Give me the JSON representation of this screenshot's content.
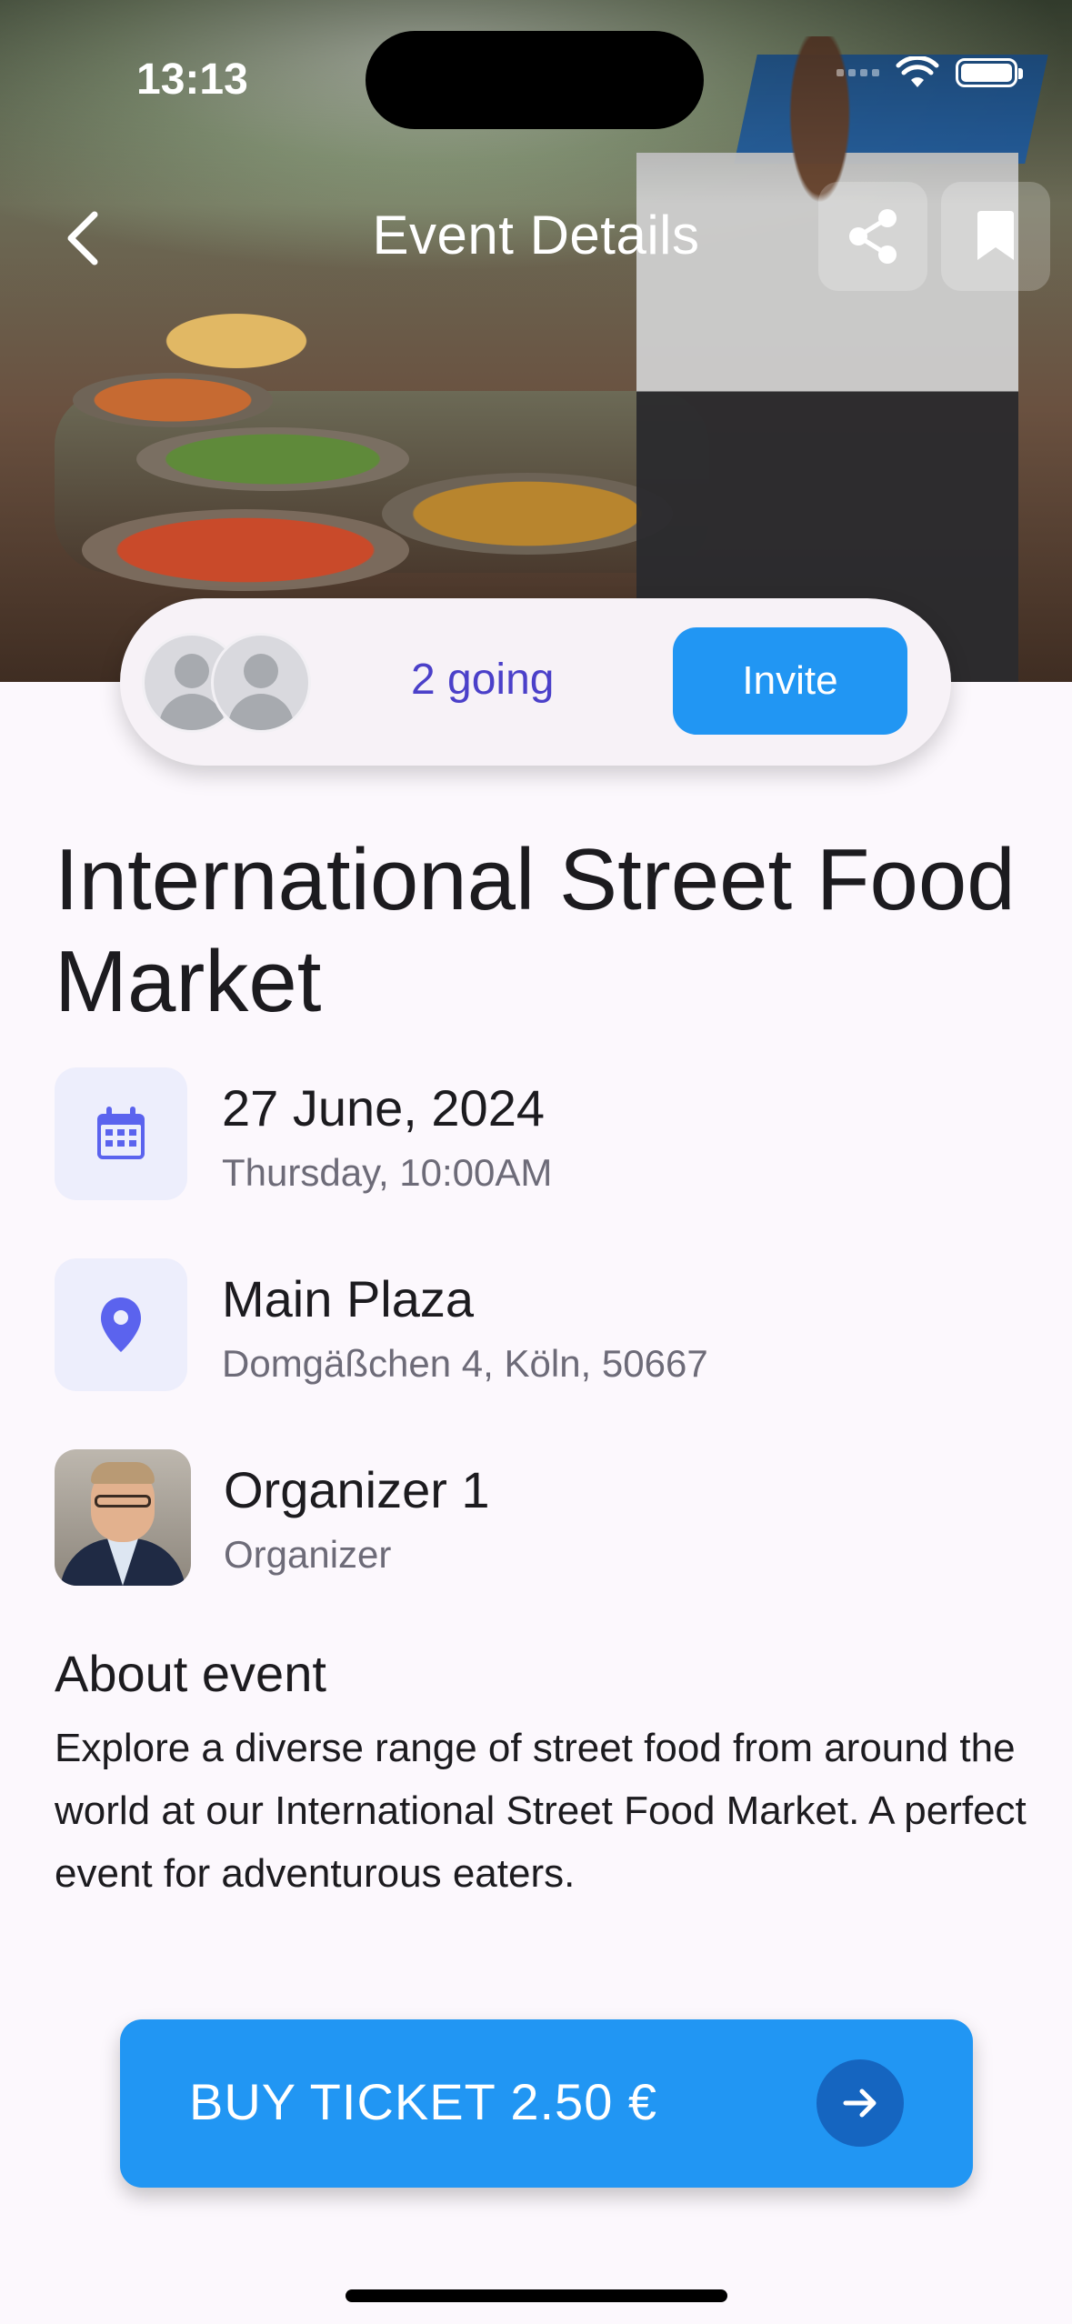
{
  "status_bar": {
    "time": "13:13"
  },
  "header": {
    "title": "Event Details"
  },
  "attendees": {
    "going_text": "2 going",
    "invite_label": "Invite"
  },
  "event": {
    "title": "International Street Food Market",
    "date": "27 June, 2024",
    "day_time": "Thursday, 10:00AM",
    "venue": "Main Plaza",
    "address": "Domgäßchen 4, Köln, 50667",
    "organizer_name": "Organizer 1",
    "organizer_role": "Organizer"
  },
  "about": {
    "heading": "About event",
    "text": "Explore a diverse range of street food from around the world at our International Street Food Market. A perfect event for adventurous eaters."
  },
  "cta": {
    "label": "BUY TICKET 2.50 €"
  },
  "icons": {
    "back": "chevron-left-icon",
    "share": "share-icon",
    "bookmark": "bookmark-icon",
    "calendar": "calendar-icon",
    "location": "location-pin-icon",
    "arrow": "arrow-right-icon"
  },
  "colors": {
    "primary": "#2196f3",
    "primary_dark": "#1565c0",
    "accent_text": "#4b40c9",
    "icon_tint": "#5b63ee",
    "icon_bg": "#edeefc",
    "background": "#fcf8fd"
  }
}
